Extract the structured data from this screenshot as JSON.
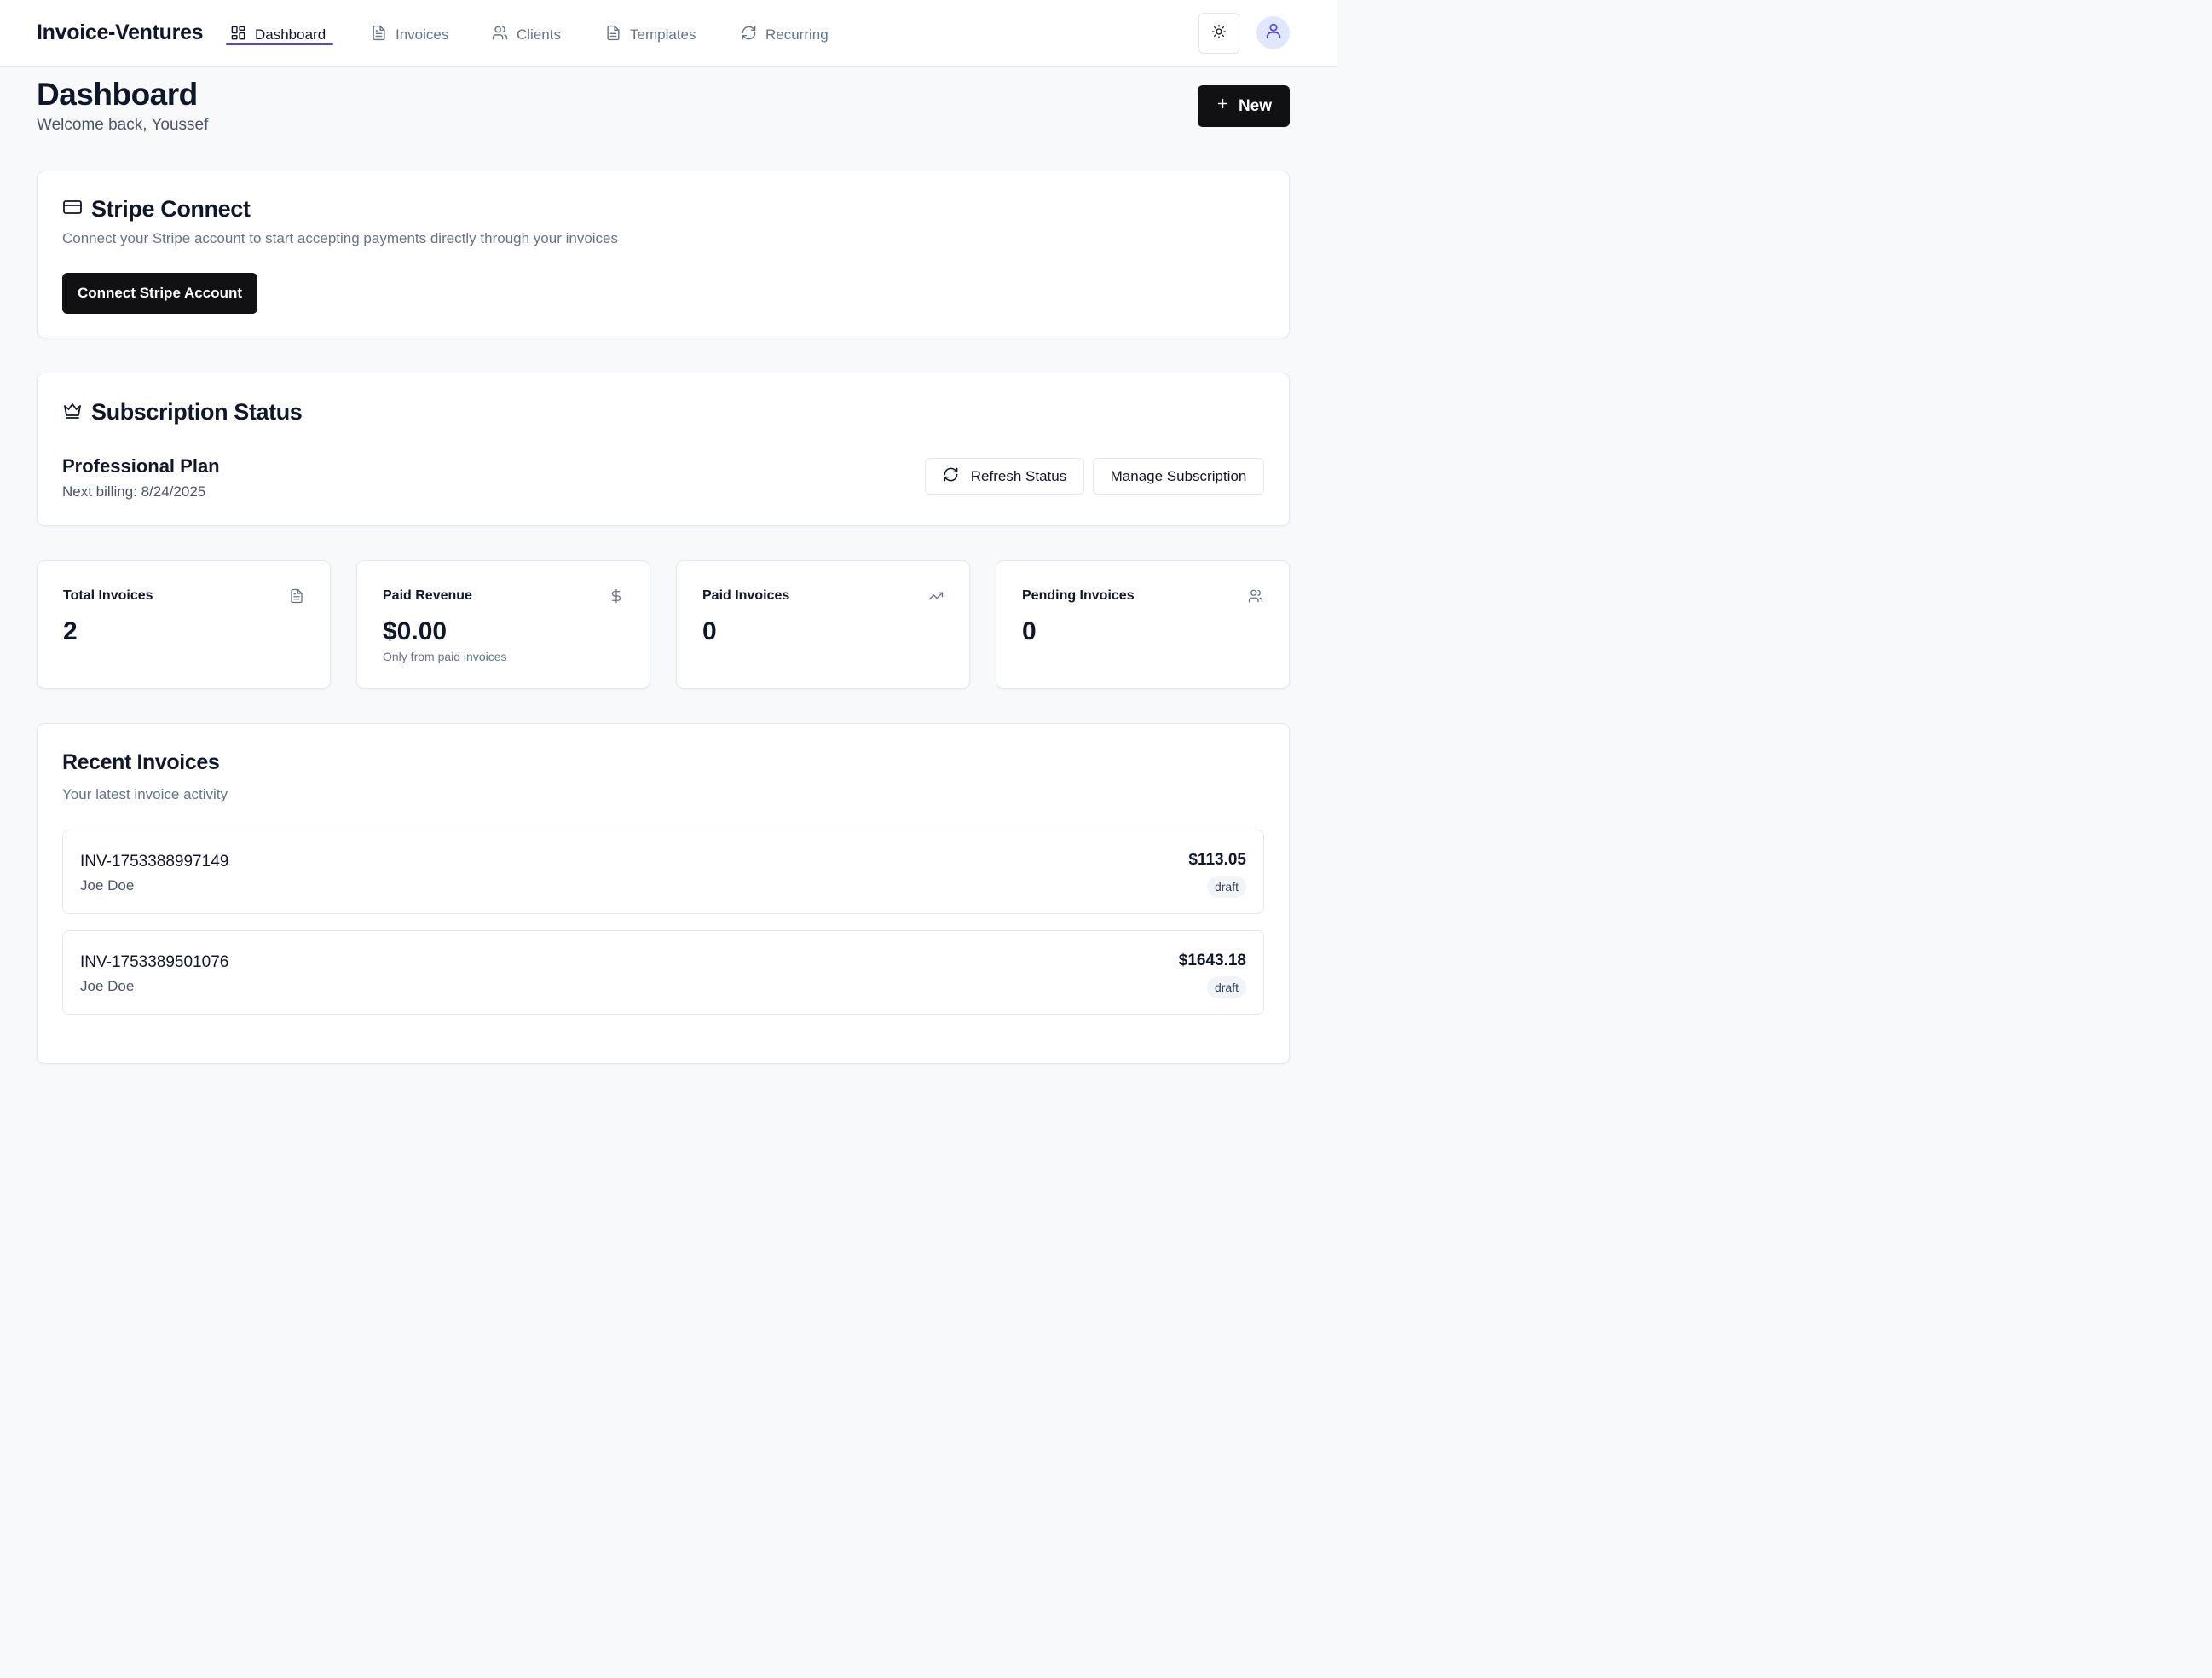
{
  "app": {
    "brand": "Invoice-Ventures",
    "nav": [
      {
        "label": "Dashboard",
        "icon": "layout-grid-icon",
        "active": true
      },
      {
        "label": "Invoices",
        "icon": "file-text-icon",
        "active": false
      },
      {
        "label": "Clients",
        "icon": "users-icon",
        "active": false
      },
      {
        "label": "Templates",
        "icon": "file-icon",
        "active": false
      },
      {
        "label": "Recurring",
        "icon": "refresh-icon",
        "active": false
      }
    ],
    "accent": "#4f46e5"
  },
  "header": {
    "title": "Dashboard",
    "welcome": "Welcome back, Youssef",
    "new_label": "New"
  },
  "stripe": {
    "title": "Stripe Connect",
    "description": "Connect your Stripe account to start accepting payments directly through your invoices",
    "button_label": "Connect Stripe Account"
  },
  "subscription": {
    "title": "Subscription Status",
    "plan": "Professional Plan",
    "next_billing": "Next billing: 8/24/2025",
    "refresh_label": "Refresh Status",
    "manage_label": "Manage Subscription"
  },
  "stats": [
    {
      "label": "Total Invoices",
      "value": "2",
      "note": "",
      "icon": "file-text-icon"
    },
    {
      "label": "Paid Revenue",
      "value": "$0.00",
      "note": "Only from paid invoices",
      "icon": "dollar-icon"
    },
    {
      "label": "Paid Invoices",
      "value": "0",
      "note": "",
      "icon": "trending-up-icon"
    },
    {
      "label": "Pending Invoices",
      "value": "0",
      "note": "",
      "icon": "users-icon"
    }
  ],
  "recent": {
    "title": "Recent Invoices",
    "subtitle": "Your latest invoice activity",
    "items": [
      {
        "number": "INV-1753388997149",
        "client": "Joe Doe",
        "amount": "$113.05",
        "status": "draft"
      },
      {
        "number": "INV-1753389501076",
        "client": "Joe Doe",
        "amount": "$1643.18",
        "status": "draft"
      }
    ]
  }
}
